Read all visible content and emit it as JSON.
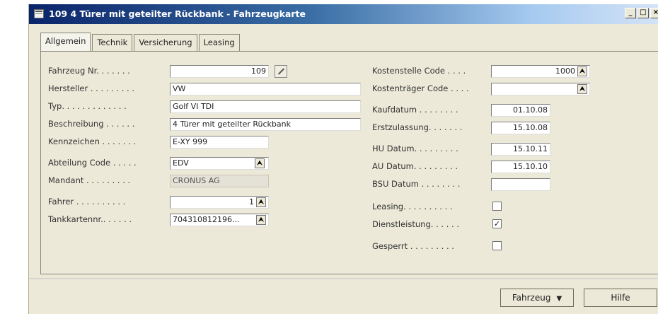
{
  "window": {
    "title": "109 4 Türer mit geteilter Rückbank - Fahrzeugkarte",
    "controls": [
      "_",
      "□",
      "×"
    ]
  },
  "tabs": [
    "Allgemein",
    "Technik",
    "Versicherung",
    "Leasing"
  ],
  "left_fields": {
    "fahrzeug_nr": {
      "label": "Fahrzeug Nr. . . . . . .",
      "value": "109"
    },
    "hersteller": {
      "label": "Hersteller . . . . . . . . .",
      "value": "VW"
    },
    "typ": {
      "label": "Typ. . . . . . . . . . . . .",
      "value": "Golf VI TDI"
    },
    "beschreibung": {
      "label": "Beschreibung . . . . . .",
      "value": "4 Türer mit geteilter Rückbank"
    },
    "kennzeichen": {
      "label": "Kennzeichen . . . . . . .",
      "value": "E-XY 999"
    },
    "abteilung_code": {
      "label": "Abteilung Code . . . . .",
      "value": "EDV"
    },
    "mandant": {
      "label": "Mandant . . . . . . . . .",
      "value": "CRONUS AG"
    },
    "fahrer": {
      "label": "Fahrer . . . . . . . . . .",
      "value": "1"
    },
    "tankkartennr": {
      "label": "Tankkartennr.. . . . . .",
      "value": "704310812196..."
    }
  },
  "right_fields": {
    "kostenstelle_code": {
      "label": "Kostenstelle Code . . . .",
      "value": "1000"
    },
    "kostentraeger_code": {
      "label": "Kostenträger Code . . . .",
      "value": ""
    },
    "kaufdatum": {
      "label": "Kaufdatum . . . . . . . .",
      "value": "01.10.08"
    },
    "erstzulassung": {
      "label": "Erstzulassung. . . . . . .",
      "value": "15.10.08"
    },
    "hu_datum": {
      "label": "HU Datum. . . . . . . . .",
      "value": "15.10.11"
    },
    "au_datum": {
      "label": "AU Datum. . . . . . . . .",
      "value": "15.10.10"
    },
    "bsu_datum": {
      "label": "BSU Datum . . . . . . . .",
      "value": ""
    },
    "leasing": {
      "label": "Leasing. . . . . . . . . .",
      "checked": false
    },
    "dienstleistung": {
      "label": "Dienstleistung. . . . . .",
      "checked": true
    },
    "gesperrt": {
      "label": "Gesperrt . . . . . . . . .",
      "checked": false
    }
  },
  "buttons": {
    "fahrzeug": "Fahrzeug",
    "hilfe": "Hilfe"
  },
  "glyphs": {
    "lookup": "⮝",
    "check": "✓",
    "dropdown": "▼"
  }
}
